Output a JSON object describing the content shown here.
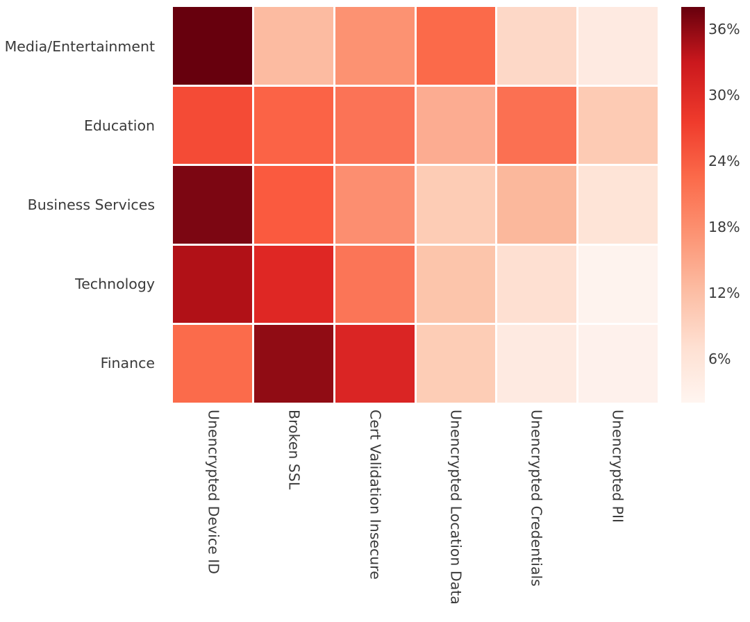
{
  "chart_data": {
    "type": "heatmap",
    "title": "",
    "xlabel": "",
    "ylabel": "",
    "x_tick_labels": [
      "Unencrypted Device ID",
      "Broken SSL",
      "Cert Validation Insecure",
      "Unencrypted Location Data",
      "Unencrypted Credentials",
      "Unencrypted PII"
    ],
    "y_tick_labels": [
      "Media/Entertainment",
      "Education",
      "Business Services",
      "Technology",
      "Finance"
    ],
    "values": [
      [
        37.5,
        12.0,
        16.0,
        22.0,
        7.5,
        4.0
      ],
      [
        24.0,
        22.0,
        20.0,
        13.0,
        20.0,
        10.0
      ],
      [
        36.5,
        22.0,
        17.5,
        10.0,
        12.5,
        6.0
      ],
      [
        29.0,
        26.0,
        20.0,
        12.0,
        7.0,
        4.5
      ],
      [
        21.0,
        33.0,
        26.0,
        11.0,
        4.0,
        3.5
      ]
    ],
    "cell_colors": [
      [
        "#67000d",
        "#fcbba1",
        "#fc9272",
        "#fb6a4a",
        "#fdd8c7",
        "#feeae1"
      ],
      [
        "#f44b36",
        "#fb6346",
        "#fb7356",
        "#fcac91",
        "#fb7052",
        "#fdcbb4"
      ],
      [
        "#7c0612",
        "#fa5a3f",
        "#fc8e70",
        "#fdccb5",
        "#fbb89c",
        "#fee4d7"
      ],
      [
        "#b11117",
        "#df2724",
        "#fb7557",
        "#fcc5ab",
        "#fee0d2",
        "#fef3ee"
      ],
      [
        "#fb6b4b",
        "#900c14",
        "#da2524",
        "#fdcdb6",
        "#feeae1",
        "#fef1ec"
      ]
    ],
    "colorbar": {
      "vmin": 2,
      "vmax": 38,
      "unit": "%",
      "colormap": "Reds",
      "tick_labels": [
        "6%",
        "12%",
        "18%",
        "24%",
        "30%",
        "36%"
      ],
      "tick_values": [
        6,
        12,
        18,
        24,
        30,
        36
      ],
      "position": "right"
    },
    "grid": false,
    "background_color": "#ffffff",
    "text_color": "#3a3a3a"
  }
}
